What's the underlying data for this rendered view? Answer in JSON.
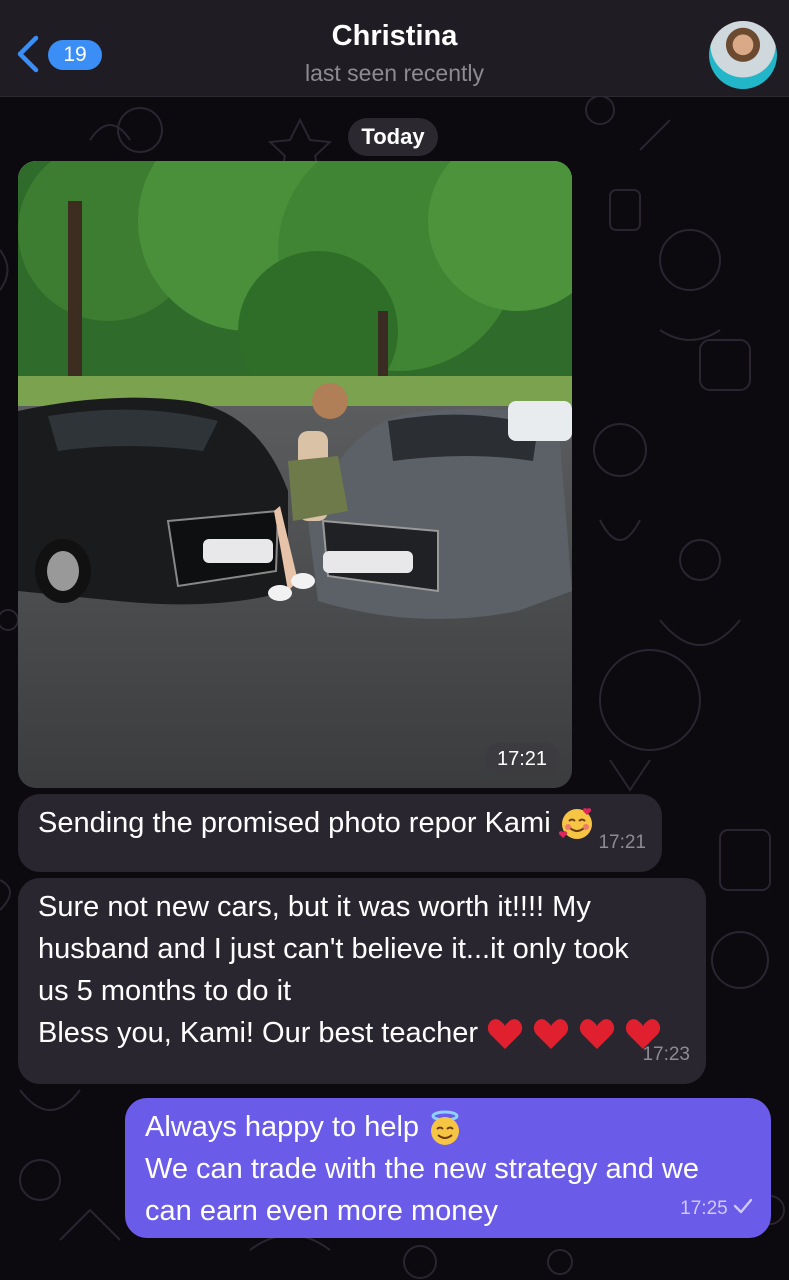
{
  "header": {
    "back_badge": "19",
    "title": "Christina",
    "subtitle": "last seen recently"
  },
  "chat": {
    "date_label": "Today",
    "photo_time": "17:21",
    "messages": [
      {
        "direction": "incoming",
        "lines": [
          "Sending the promised photo repor Kami"
        ],
        "emoji": "smiling-face-with-hearts",
        "time": "17:21"
      },
      {
        "direction": "incoming",
        "lines": [
          "Sure not new cars, but it was worth it!!!! My",
          "husband and I just can't believe it...it only took",
          "us 5 months to do it",
          "Bless you, Kami! Our best teacher"
        ],
        "emoji": "red-heart x4",
        "time": "17:23"
      },
      {
        "direction": "outgoing",
        "lines": [
          "Always happy to help",
          "We can trade with the new strategy and we",
          "can earn even more money"
        ],
        "emoji": "smiling-face-with-halo",
        "time": "17:25",
        "status": "sent-check"
      }
    ]
  },
  "colors": {
    "header_bg": "#1f1c24",
    "incoming_bubble": "#2a2630",
    "outgoing_bubble": "#6a5ce8",
    "accent": "#3a8ef5"
  }
}
